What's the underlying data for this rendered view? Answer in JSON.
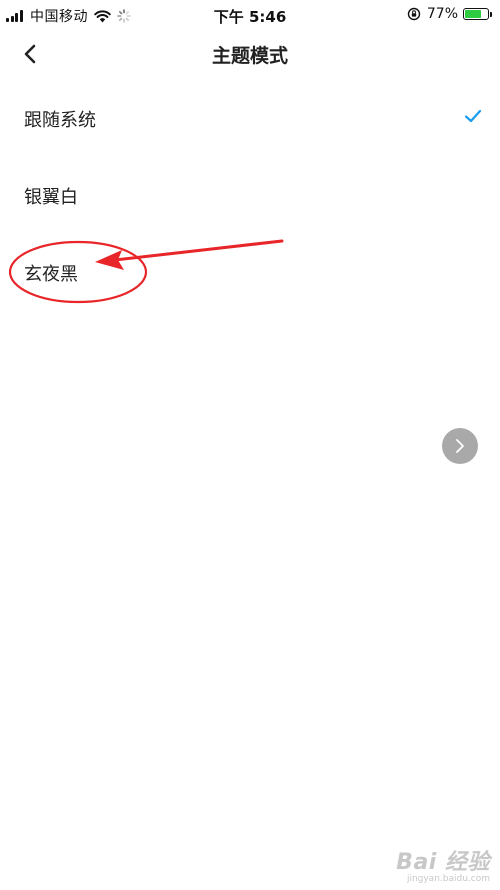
{
  "status_bar": {
    "carrier": "中国移动",
    "time": "下午 5:46",
    "battery_percent": "77%",
    "battery_level": 0.77
  },
  "header": {
    "title": "主题模式"
  },
  "options": [
    {
      "label": "跟随系统",
      "selected": true
    },
    {
      "label": "银翼白",
      "selected": false
    },
    {
      "label": "玄夜黑",
      "selected": false
    }
  ],
  "colors": {
    "accent": "#1a9cf0",
    "annotation": "#e8262a",
    "float_button": "#a9a9a9",
    "battery": "#2ecc40"
  },
  "watermark": {
    "logo_text": "Bai 经验",
    "url": "jingyan.baidu.com"
  }
}
